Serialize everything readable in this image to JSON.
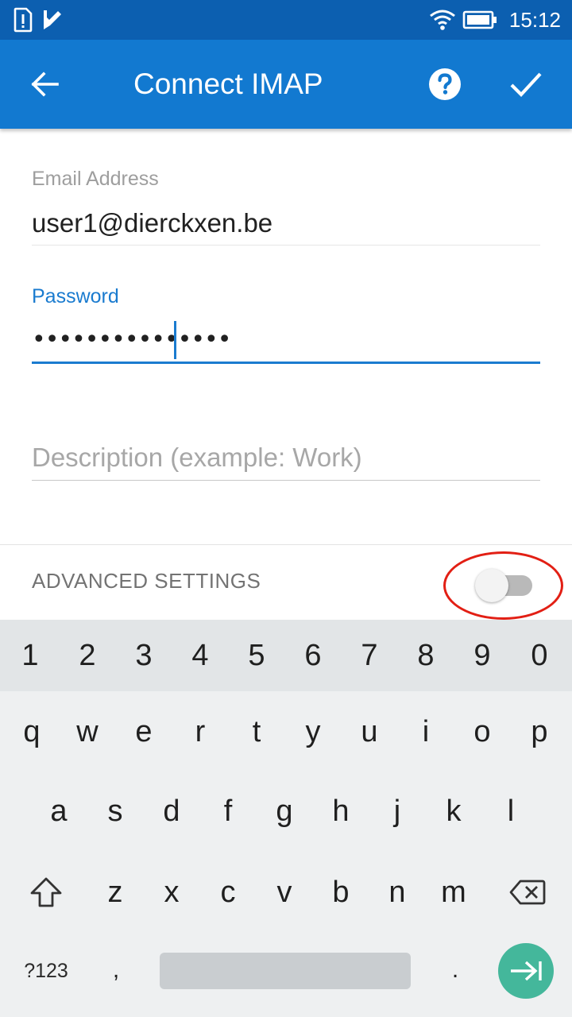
{
  "status_bar": {
    "time": "15:12",
    "icons": [
      "sim-alert-icon",
      "task-check-icon",
      "wifi-icon",
      "battery-icon"
    ]
  },
  "app_bar": {
    "title": "Connect IMAP",
    "back_icon": "arrow-left-icon",
    "help_icon": "help-circle-icon",
    "confirm_icon": "check-icon",
    "color": "#1279d0"
  },
  "form": {
    "email": {
      "label": "Email Address",
      "value": "user1@dierckxen.be"
    },
    "password": {
      "label": "Password",
      "masked_value": "•••••••••••••••",
      "focused": true
    },
    "description": {
      "placeholder": "Description (example: Work)",
      "value": ""
    }
  },
  "advanced_settings": {
    "label": "ADVANCED SETTINGS",
    "enabled": false
  },
  "keyboard": {
    "number_row": [
      "1",
      "2",
      "3",
      "4",
      "5",
      "6",
      "7",
      "8",
      "9",
      "0"
    ],
    "row1": [
      "q",
      "w",
      "e",
      "r",
      "t",
      "y",
      "u",
      "i",
      "o",
      "p"
    ],
    "row2": [
      "a",
      "s",
      "d",
      "f",
      "g",
      "h",
      "j",
      "k",
      "l"
    ],
    "row3": [
      "z",
      "x",
      "c",
      "v",
      "b",
      "n",
      "m"
    ],
    "symbols_label": "?123",
    "comma": ",",
    "period": ".",
    "enter_color": "#44b79b"
  }
}
